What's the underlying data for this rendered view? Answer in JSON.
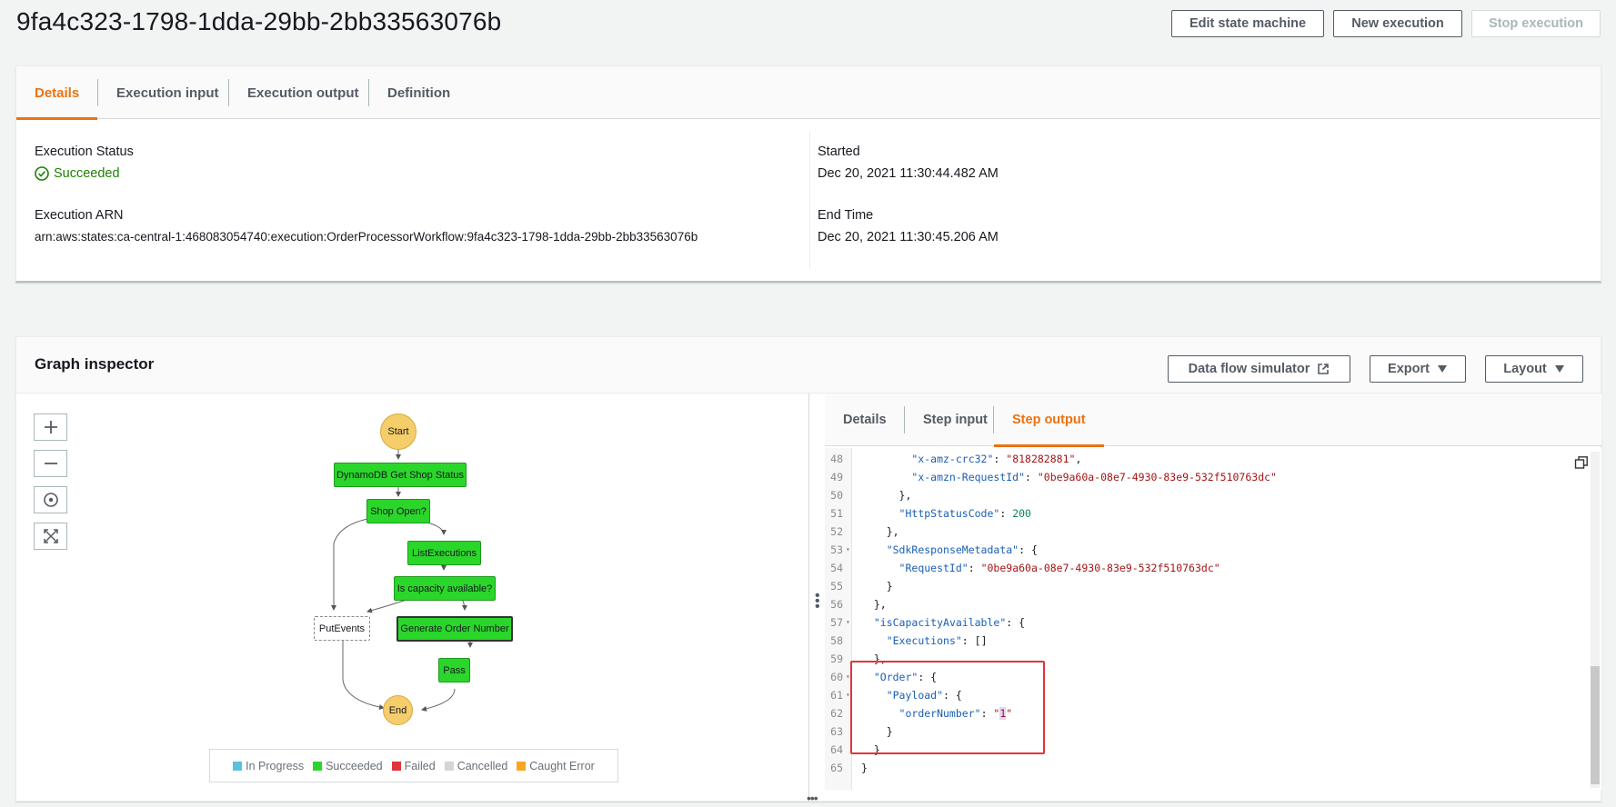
{
  "page": {
    "title": "9fa4c323-1798-1dda-29bb-2bb33563076b"
  },
  "header_buttons": {
    "edit": "Edit state machine",
    "new_execution": "New execution",
    "stop": "Stop execution"
  },
  "details": {
    "tabs": [
      "Details",
      "Execution input",
      "Execution output",
      "Definition"
    ],
    "status_label": "Execution Status",
    "status_value": "Succeeded",
    "arn_label": "Execution ARN",
    "arn_value": "arn:aws:states:ca-central-1:468083054740:execution:OrderProcessorWorkflow:9fa4c323-1798-1dda-29bb-2bb33563076b",
    "started_label": "Started",
    "started_value": "Dec 20, 2021 11:30:44.482 AM",
    "end_label": "End Time",
    "end_value": "Dec 20, 2021 11:30:45.206 AM"
  },
  "graph_inspector": {
    "title": "Graph inspector",
    "buttons": {
      "simulator": "Data flow simulator",
      "export": "Export",
      "layout": "Layout"
    },
    "nodes": {
      "start": "Start",
      "get_shop_status": "DynamoDB Get Shop Status",
      "shop_open": "Shop Open?",
      "list_executions": "ListExecutions",
      "capacity": "Is capacity available?",
      "put_events": "PutEvents",
      "generate_order": "Generate Order Number",
      "pass": "Pass",
      "end": "End"
    },
    "legend": [
      {
        "label": "In Progress",
        "color": "#5bc0de"
      },
      {
        "label": "Succeeded",
        "color": "#2bd62b"
      },
      {
        "label": "Failed",
        "color": "#e0343b"
      },
      {
        "label": "Cancelled",
        "color": "#d5d5d5"
      },
      {
        "label": "Caught Error",
        "color": "#f5a623"
      }
    ],
    "right_tabs": [
      "Details",
      "Step input",
      "Step output"
    ],
    "code_lines": [
      {
        "n": "48",
        "fold": "",
        "text": "        \"x-amz-crc32\": \"818282881\","
      },
      {
        "n": "49",
        "fold": "",
        "text": "        \"x-amzn-RequestId\": \"0be9a60a-08e7-4930-83e9-532f510763dc\""
      },
      {
        "n": "50",
        "fold": "",
        "text": "      },"
      },
      {
        "n": "51",
        "fold": "",
        "text": "      \"HttpStatusCode\": 200"
      },
      {
        "n": "52",
        "fold": "",
        "text": "    },"
      },
      {
        "n": "53",
        "fold": "▾",
        "text": "    \"SdkResponseMetadata\": {"
      },
      {
        "n": "54",
        "fold": "",
        "text": "      \"RequestId\": \"0be9a60a-08e7-4930-83e9-532f510763dc\""
      },
      {
        "n": "55",
        "fold": "",
        "text": "    }"
      },
      {
        "n": "56",
        "fold": "",
        "text": "  },"
      },
      {
        "n": "57",
        "fold": "▾",
        "text": "  \"isCapacityAvailable\": {"
      },
      {
        "n": "58",
        "fold": "",
        "text": "    \"Executions\": []"
      },
      {
        "n": "59",
        "fold": "",
        "text": "  },"
      },
      {
        "n": "60",
        "fold": "▾",
        "text": "  \"Order\": {"
      },
      {
        "n": "61",
        "fold": "▾",
        "text": "    \"Payload\": {"
      },
      {
        "n": "62",
        "fold": "",
        "text": "      \"orderNumber\": \"1\""
      },
      {
        "n": "63",
        "fold": "",
        "text": "    }"
      },
      {
        "n": "64",
        "fold": "",
        "text": "  }"
      },
      {
        "n": "65",
        "fold": "",
        "text": "}"
      }
    ]
  }
}
